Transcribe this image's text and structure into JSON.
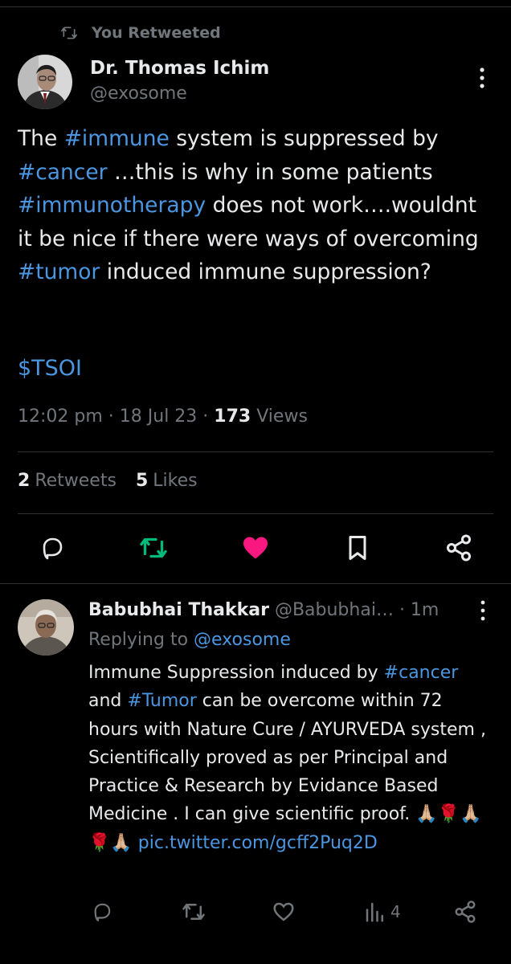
{
  "retweet_banner": {
    "label": "You Retweeted"
  },
  "tweet": {
    "author_name": "Dr. Thomas Ichim",
    "author_handle": "@exosome",
    "text": {
      "p1": "The ",
      "tag_immune": "#immune",
      "p2": " system is suppressed by ",
      "tag_cancer": "#cancer",
      "p3": " …this is why in some patients ",
      "tag_immunotherapy": "#immunotherapy",
      "p4": " does not work….wouldnt it be nice if there were ways of overcoming ",
      "tag_tumor": "#tumor",
      "p5": " induced immune suppression?"
    },
    "cashtag": "$TSOI",
    "time": "12:02 pm",
    "date": "18 Jul 23",
    "views_count": "173",
    "views_label": "Views",
    "retweets_count": "2",
    "retweets_label": "Retweets",
    "likes_count": "5",
    "likes_label": "Likes",
    "separator": " · "
  },
  "reply": {
    "author_name": "Babubhai Thakkar",
    "author_handle": "@Babubhai…",
    "time": "· 1m",
    "replying_label": "Replying to ",
    "replying_handle": "@exosome",
    "text": {
      "p1": "Immune Suppression induced by ",
      "tag_cancer": "#cancer",
      "p2": " and ",
      "tag_tumor": "#Tumor",
      "p3": " can be overcome within 72 hours with Nature Cure / AYURVEDA  system  , Scientifically proved as per Principal and Practice & Research by Evidance Based Medicine . I can give scientific proof. 🙏🏼🌹🙏🏼🌹🙏🏼",
      "link": "pic.twitter.com/gcff2Puq2D"
    },
    "views_count": "4"
  },
  "colors": {
    "background": "#000000",
    "link": "#4b96e0",
    "muted": "#71767b",
    "retweet_green": "#00ba7c",
    "like_pink": "#f91880"
  },
  "icons": {
    "retweet_banner": "retweet-icon",
    "more": "more-vertical-icon",
    "reply": "reply-bubble-icon",
    "retweet": "retweet-icon",
    "like_filled": "heart-filled-icon",
    "like_outline": "heart-outline-icon",
    "bookmark": "bookmark-icon",
    "share": "share-icon",
    "views": "analytics-icon"
  }
}
